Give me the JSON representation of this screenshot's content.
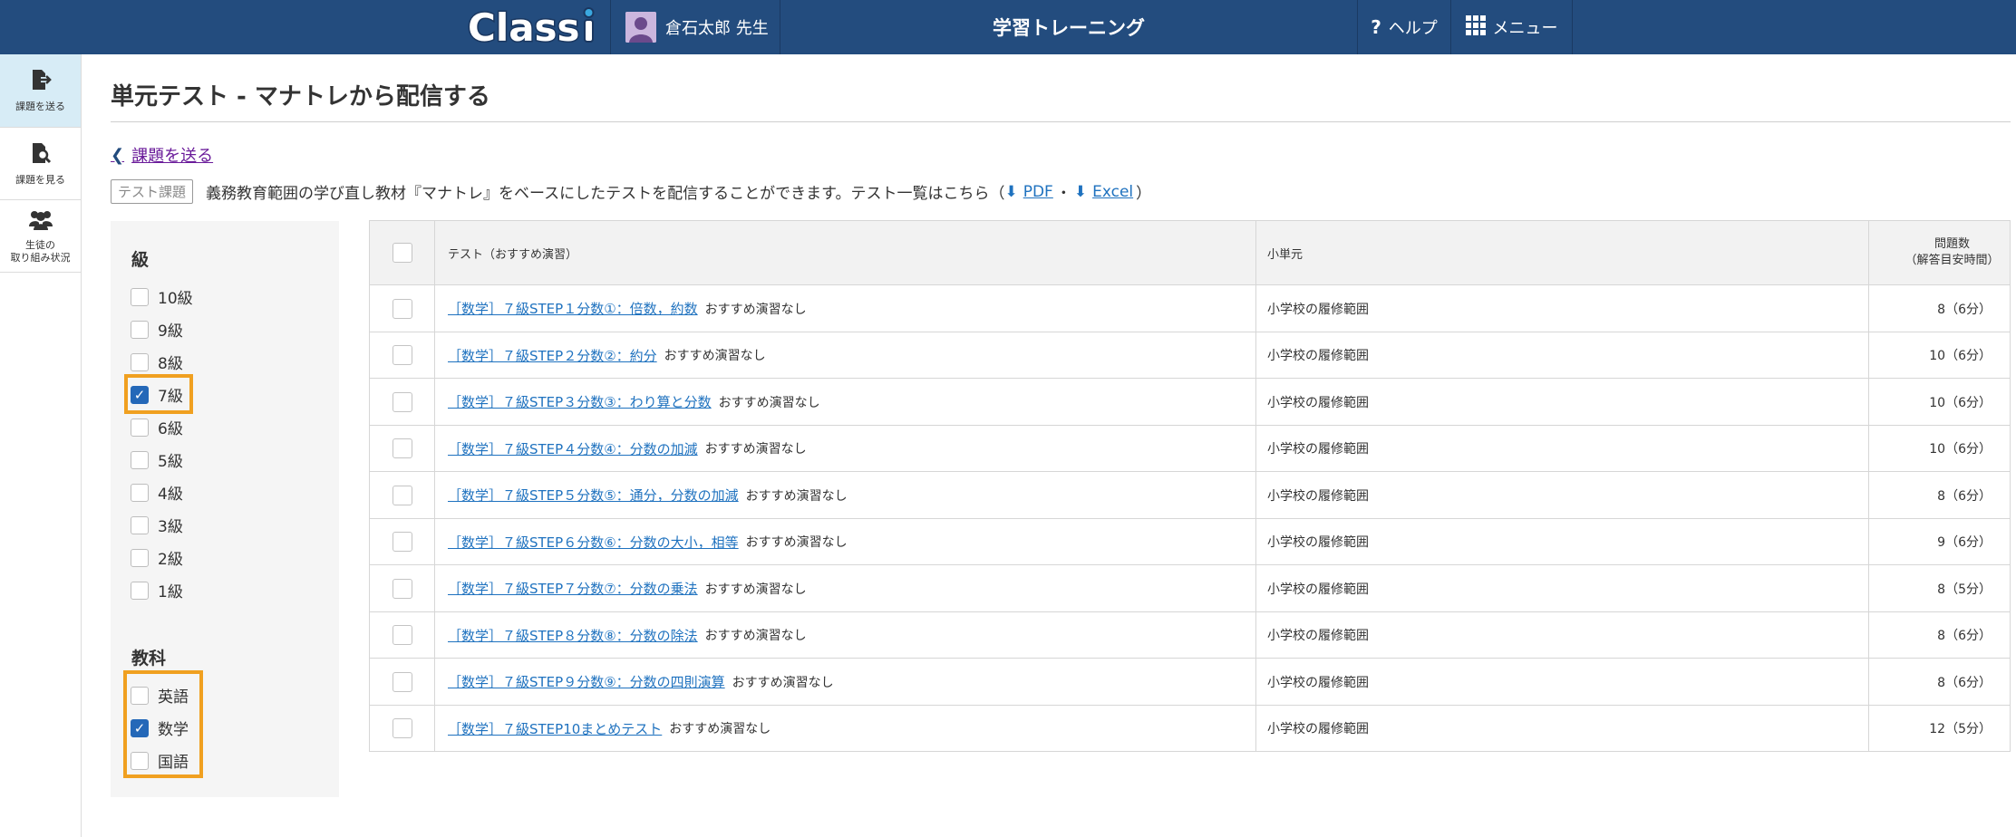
{
  "header": {
    "logo": "Classi",
    "user_name": "倉石太郎 先生",
    "app_title": "学習トレーニング",
    "help_label": "ヘルプ",
    "menu_label": "メニュー"
  },
  "sidenav": {
    "items": [
      {
        "label_line1": "課題を送る",
        "label_line2": ""
      },
      {
        "label_line1": "課題を見る",
        "label_line2": ""
      },
      {
        "label_line1": "生徒の",
        "label_line2": "取り組み状況"
      }
    ]
  },
  "page": {
    "title": "単元テスト - マナトレから配信する",
    "back_link": "課題を送る",
    "tag": "テスト課題",
    "description": "義務教育範囲の学び直し教材『マナトレ』をベースにしたテストを配信することができます。テスト一覧はこちら（",
    "pdf_label": "PDF",
    "separator": "・",
    "excel_label": "Excel",
    "close_paren": "）"
  },
  "filter": {
    "grade_heading": "級",
    "grades": [
      {
        "label": "10級",
        "checked": false
      },
      {
        "label": "9級",
        "checked": false
      },
      {
        "label": "8級",
        "checked": false
      },
      {
        "label": "7級",
        "checked": true
      },
      {
        "label": "6級",
        "checked": false
      },
      {
        "label": "5級",
        "checked": false
      },
      {
        "label": "4級",
        "checked": false
      },
      {
        "label": "3級",
        "checked": false
      },
      {
        "label": "2級",
        "checked": false
      },
      {
        "label": "1級",
        "checked": false
      }
    ],
    "subject_heading": "教科",
    "subjects": [
      {
        "label": "英語",
        "checked": false
      },
      {
        "label": "数学",
        "checked": true
      },
      {
        "label": "国語",
        "checked": false
      }
    ]
  },
  "table": {
    "headers": {
      "test": "テスト（おすすめ演習）",
      "unit": "小単元",
      "count_line1": "問題数",
      "count_line2": "（解答目安時間）"
    },
    "rows": [
      {
        "test": "［数学］７級STEP１分数①：倍数，約数",
        "rec": "おすすめ演習なし",
        "unit": "小学校の履修範囲",
        "count": "8（6分）"
      },
      {
        "test": "［数学］７級STEP２分数②：約分",
        "rec": "おすすめ演習なし",
        "unit": "小学校の履修範囲",
        "count": "10（6分）"
      },
      {
        "test": "［数学］７級STEP３分数③：わり算と分数",
        "rec": "おすすめ演習なし",
        "unit": "小学校の履修範囲",
        "count": "10（6分）"
      },
      {
        "test": "［数学］７級STEP４分数④：分数の加減",
        "rec": "おすすめ演習なし",
        "unit": "小学校の履修範囲",
        "count": "10（6分）"
      },
      {
        "test": "［数学］７級STEP５分数⑤：通分，分数の加減",
        "rec": "おすすめ演習なし",
        "unit": "小学校の履修範囲",
        "count": "8（6分）"
      },
      {
        "test": "［数学］７級STEP６分数⑥：分数の大小，相等",
        "rec": "おすすめ演習なし",
        "unit": "小学校の履修範囲",
        "count": "9（6分）"
      },
      {
        "test": "［数学］７級STEP７分数⑦：分数の乗法",
        "rec": "おすすめ演習なし",
        "unit": "小学校の履修範囲",
        "count": "8（5分）"
      },
      {
        "test": "［数学］７級STEP８分数⑧：分数の除法",
        "rec": "おすすめ演習なし",
        "unit": "小学校の履修範囲",
        "count": "8（6分）"
      },
      {
        "test": "［数学］７級STEP９分数⑨：分数の四則演算",
        "rec": "おすすめ演習なし",
        "unit": "小学校の履修範囲",
        "count": "8（6分）"
      },
      {
        "test": "［数学］７級STEP10まとめテスト",
        "rec": "おすすめ演習なし",
        "unit": "小学校の履修範囲",
        "count": "12（5分）"
      }
    ]
  },
  "colors": {
    "header_bg": "#234c7e",
    "active_nav_bg": "#d7ecf6",
    "link": "#1f72bf",
    "highlight": "#f0a020",
    "checkbox_on": "#2468b8"
  }
}
